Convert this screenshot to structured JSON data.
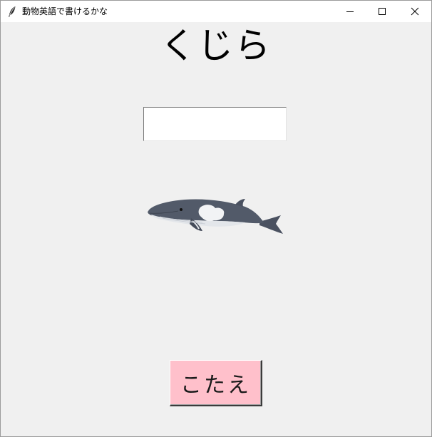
{
  "window": {
    "title": "動物英語で書けるかな",
    "icon": "feather-icon",
    "controls": [
      "minimize-icon",
      "maximize-icon",
      "close-icon"
    ]
  },
  "main": {
    "word": "くじら",
    "answer_input": {
      "value": "",
      "placeholder": ""
    },
    "image": "whale-illustration",
    "answer_button_label": "こたえ"
  },
  "colors": {
    "window_bg": "#f0f0f0",
    "button_bg": "#ffc0cb",
    "titlebar_bg": "#ffffff"
  }
}
